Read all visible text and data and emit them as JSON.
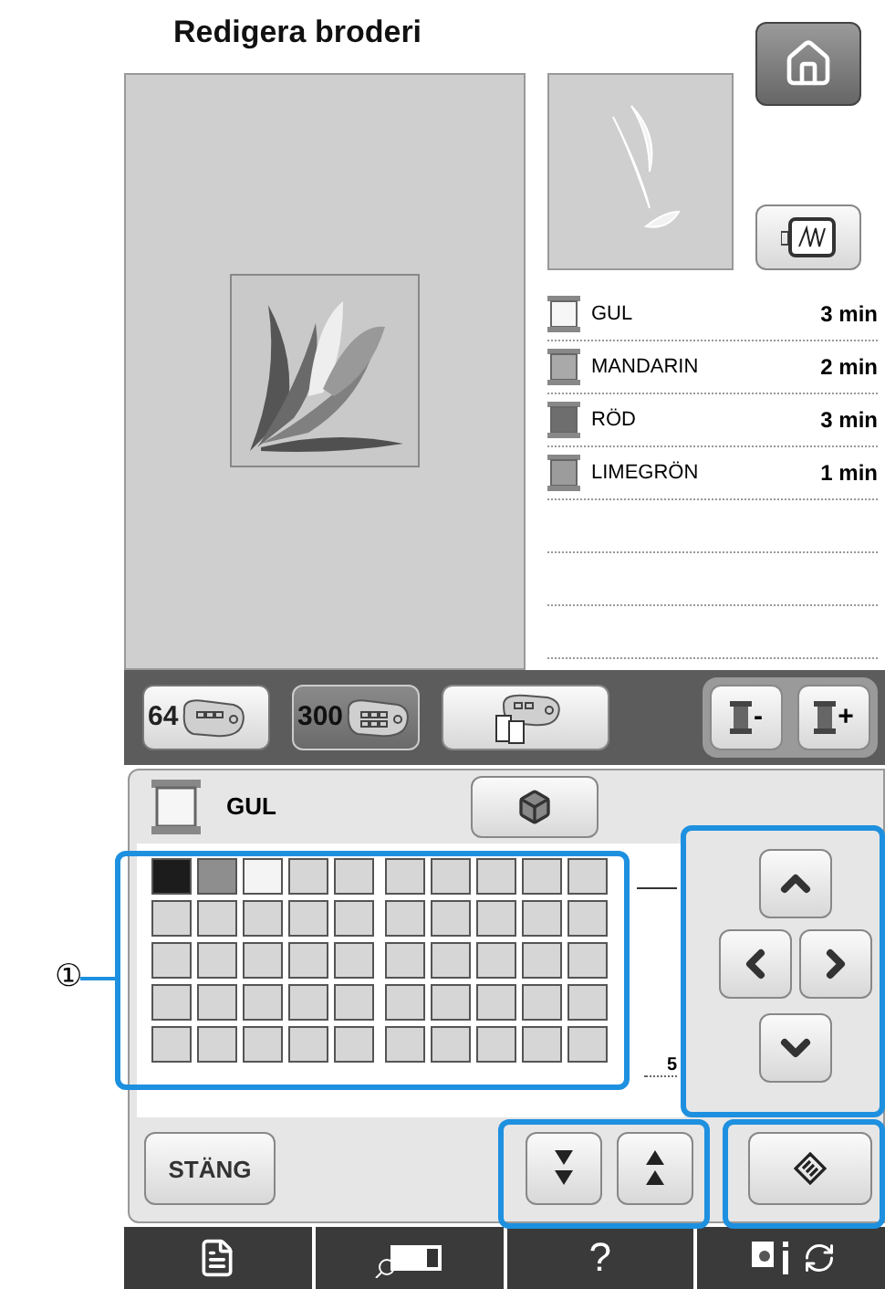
{
  "title": "Redigera broderi",
  "threads": [
    {
      "name": "GUL",
      "time": "3 min",
      "color": "#f6f6f6"
    },
    {
      "name": "MANDARIN",
      "time": "2 min",
      "color": "#a9a9a9"
    },
    {
      "name": "RÖD",
      "time": "3 min",
      "color": "#6e6e6e"
    },
    {
      "name": "LIMEGRÖN",
      "time": "1 min",
      "color": "#9c9c9c"
    }
  ],
  "palette_buttons": [
    {
      "label": "64",
      "selected": false
    },
    {
      "label": "300",
      "selected": true
    }
  ],
  "spool_buttons": [
    {
      "sign": "-"
    },
    {
      "sign": "+"
    }
  ],
  "current_thread": {
    "name": "GUL",
    "color": "#f6f6f6"
  },
  "palette_rows": [
    {
      "cells": [
        {
          "color": "#1c1c1c"
        },
        {
          "color": "#8e8e8e"
        },
        {
          "color": "#f4f4f4"
        },
        {
          "color": "#d6d6d6"
        },
        {
          "color": "#d6d6d6"
        },
        {
          "color": "#d6d6d6"
        },
        {
          "color": "#d6d6d6"
        },
        {
          "color": "#d6d6d6"
        },
        {
          "color": "#d6d6d6"
        },
        {
          "color": "#d6d6d6"
        }
      ]
    },
    {
      "cells": [
        {
          "color": "#d6d6d6"
        },
        {
          "color": "#d6d6d6"
        },
        {
          "color": "#d6d6d6"
        },
        {
          "color": "#d6d6d6"
        },
        {
          "color": "#d6d6d6"
        },
        {
          "color": "#d6d6d6"
        },
        {
          "color": "#d6d6d6"
        },
        {
          "color": "#d6d6d6"
        },
        {
          "color": "#d6d6d6"
        },
        {
          "color": "#d6d6d6"
        }
      ]
    },
    {
      "cells": [
        {
          "color": "#d6d6d6"
        },
        {
          "color": "#d6d6d6"
        },
        {
          "color": "#d6d6d6"
        },
        {
          "color": "#d6d6d6"
        },
        {
          "color": "#d6d6d6"
        },
        {
          "color": "#d6d6d6"
        },
        {
          "color": "#d6d6d6"
        },
        {
          "color": "#d6d6d6"
        },
        {
          "color": "#d6d6d6"
        },
        {
          "color": "#d6d6d6"
        }
      ]
    },
    {
      "cells": [
        {
          "color": "#d6d6d6"
        },
        {
          "color": "#d6d6d6"
        },
        {
          "color": "#d6d6d6"
        },
        {
          "color": "#d6d6d6"
        },
        {
          "color": "#d6d6d6"
        },
        {
          "color": "#d6d6d6"
        },
        {
          "color": "#d6d6d6"
        },
        {
          "color": "#d6d6d6"
        },
        {
          "color": "#d6d6d6"
        },
        {
          "color": "#d6d6d6"
        }
      ]
    },
    {
      "cells": [
        {
          "color": "#d6d6d6"
        },
        {
          "color": "#d6d6d6"
        },
        {
          "color": "#d6d6d6"
        },
        {
          "color": "#d6d6d6"
        },
        {
          "color": "#d6d6d6"
        },
        {
          "color": "#d6d6d6"
        },
        {
          "color": "#d6d6d6"
        },
        {
          "color": "#d6d6d6"
        },
        {
          "color": "#d6d6d6"
        },
        {
          "color": "#d6d6d6"
        }
      ]
    }
  ],
  "page_number": "5",
  "close_button": "STÄNG",
  "help_label": "?",
  "callout": "①"
}
